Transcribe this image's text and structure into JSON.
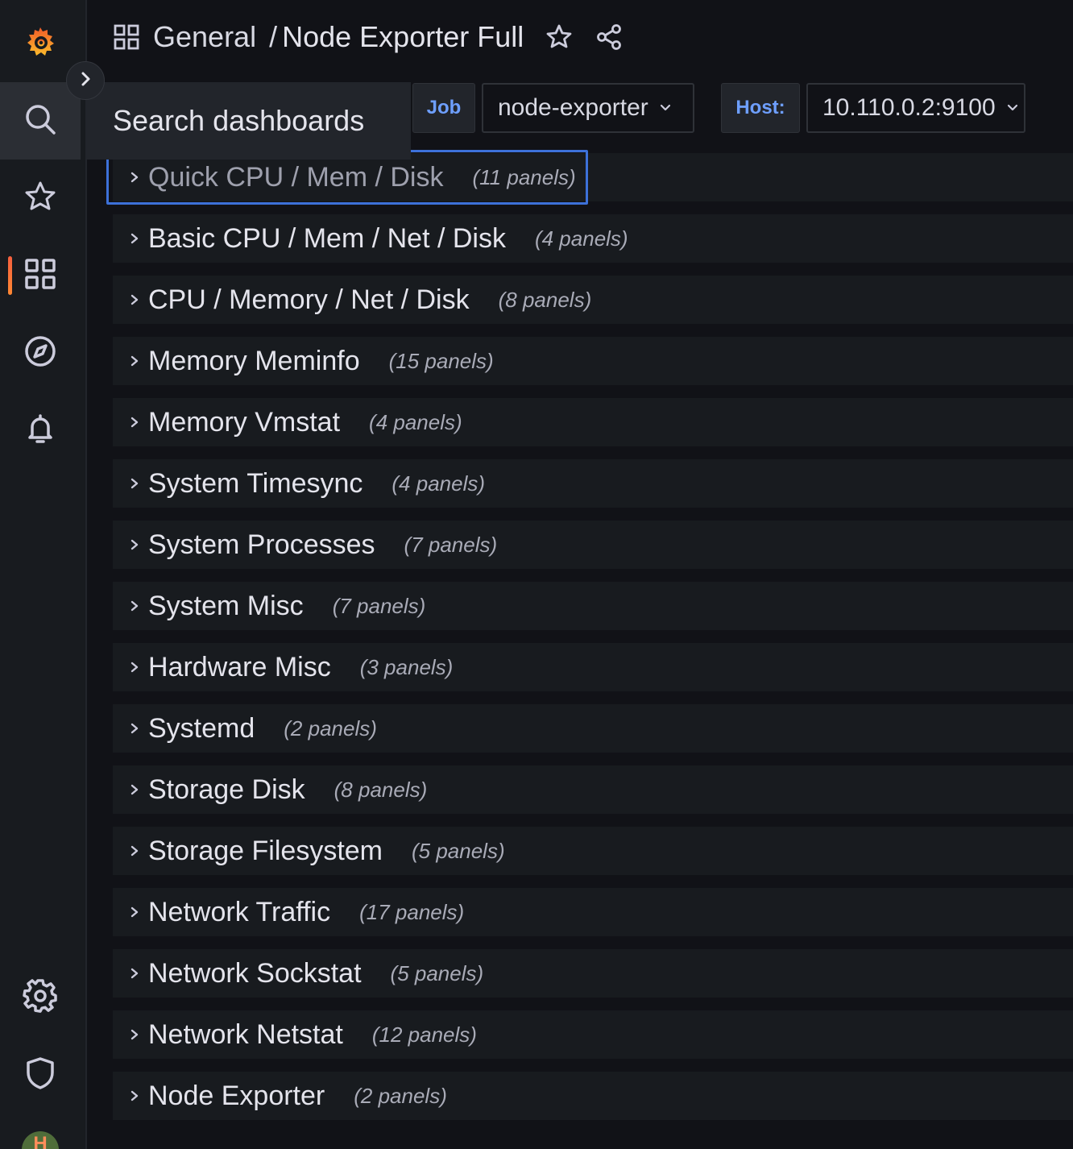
{
  "header": {
    "breadcrumb_folder": "General",
    "breadcrumb_separator": "/",
    "dashboard_title": "Node Exporter Full"
  },
  "sidebar": {
    "items": [
      {
        "name": "grafana-logo-icon"
      },
      {
        "name": "search-icon",
        "tooltip": "Search dashboards"
      },
      {
        "name": "star-icon"
      },
      {
        "name": "dashboards-icon",
        "active": true
      },
      {
        "name": "explore-compass-icon"
      },
      {
        "name": "alerting-bell-icon"
      },
      {
        "name": "gear-icon"
      },
      {
        "name": "shield-icon"
      }
    ],
    "avatar_letter": "H"
  },
  "tooltip": {
    "text": "Search dashboards"
  },
  "variables": {
    "job_label": "Job",
    "job_value": "node-exporter",
    "host_label": "Host:",
    "host_value": "10.110.0.2:9100"
  },
  "rows": [
    {
      "title": "Quick CPU / Mem / Disk",
      "count": "(11 panels)"
    },
    {
      "title": "Basic CPU / Mem / Net / Disk",
      "count": "(4 panels)"
    },
    {
      "title": "CPU / Memory / Net / Disk",
      "count": "(8 panels)"
    },
    {
      "title": "Memory Meminfo",
      "count": "(15 panels)"
    },
    {
      "title": "Memory Vmstat",
      "count": "(4 panels)"
    },
    {
      "title": "System Timesync",
      "count": "(4 panels)"
    },
    {
      "title": "System Processes",
      "count": "(7 panels)"
    },
    {
      "title": "System Misc",
      "count": "(7 panels)"
    },
    {
      "title": "Hardware Misc",
      "count": "(3 panels)"
    },
    {
      "title": "Systemd",
      "count": "(2 panels)"
    },
    {
      "title": "Storage Disk",
      "count": "(8 panels)"
    },
    {
      "title": "Storage Filesystem",
      "count": "(5 panels)"
    },
    {
      "title": "Network Traffic",
      "count": "(17 panels)"
    },
    {
      "title": "Network Sockstat",
      "count": "(5 panels)"
    },
    {
      "title": "Network Netstat",
      "count": "(12 panels)"
    },
    {
      "title": "Node Exporter",
      "count": "(2 panels)"
    }
  ],
  "colors": {
    "background": "#111217",
    "sidebar": "#181b1f",
    "row": "#181b1f",
    "variable_label": "#6e9fff",
    "focus_ring": "#3d71d9",
    "active_indicator": "#f55f3e"
  }
}
